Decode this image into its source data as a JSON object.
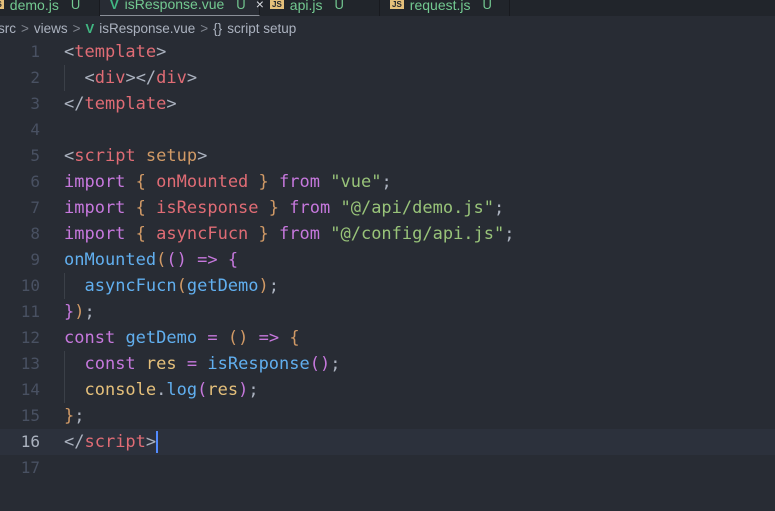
{
  "tabs": [
    {
      "label": "demo.js",
      "status": "U",
      "icon": "js-icon",
      "active": false
    },
    {
      "label": "isResponse.vue",
      "status": "U",
      "icon": "vue-icon",
      "active": true
    },
    {
      "label": "api.js",
      "status": "U",
      "icon": "js-icon",
      "active": false
    },
    {
      "label": "request.js",
      "status": "U",
      "icon": "js-icon",
      "active": false
    }
  ],
  "tab_close": "×",
  "js_badge": "JS",
  "breadcrumb": {
    "items": [
      "src",
      "views",
      "isResponse.vue",
      "script setup"
    ],
    "sep": ">",
    "braces": "{}",
    "vue_glyph": "V"
  },
  "current_line": 16,
  "line_numbers": [
    "1",
    "2",
    "3",
    "4",
    "5",
    "6",
    "7",
    "8",
    "9",
    "10",
    "11",
    "12",
    "13",
    "14",
    "15",
    "16",
    "17"
  ],
  "code": [
    [
      [
        "<",
        "punc"
      ],
      [
        "template",
        "tag"
      ],
      [
        ">",
        "punc"
      ]
    ],
    [
      [
        "  ",
        "punc"
      ],
      [
        "<",
        "punc"
      ],
      [
        "div",
        "tag"
      ],
      [
        "></",
        "punc"
      ],
      [
        "div",
        "tag"
      ],
      [
        ">",
        "punc"
      ]
    ],
    [
      [
        "</",
        "punc"
      ],
      [
        "template",
        "tag"
      ],
      [
        ">",
        "punc"
      ]
    ],
    [],
    [
      [
        "<",
        "punc"
      ],
      [
        "script",
        "tag"
      ],
      [
        " ",
        "punc"
      ],
      [
        "setup",
        "attr"
      ],
      [
        ">",
        "punc"
      ]
    ],
    [
      [
        "import",
        "kw"
      ],
      [
        " ",
        "punc"
      ],
      [
        "{",
        "brace"
      ],
      [
        " ",
        "punc"
      ],
      [
        "onMounted",
        "var"
      ],
      [
        " ",
        "punc"
      ],
      [
        "}",
        "brace"
      ],
      [
        " ",
        "punc"
      ],
      [
        "from",
        "kw"
      ],
      [
        " ",
        "punc"
      ],
      [
        "\"vue\"",
        "str"
      ],
      [
        ";",
        "punc"
      ]
    ],
    [
      [
        "import",
        "kw"
      ],
      [
        " ",
        "punc"
      ],
      [
        "{",
        "brace"
      ],
      [
        " ",
        "punc"
      ],
      [
        "isResponse",
        "var"
      ],
      [
        " ",
        "punc"
      ],
      [
        "}",
        "brace"
      ],
      [
        " ",
        "punc"
      ],
      [
        "from",
        "kw"
      ],
      [
        " ",
        "punc"
      ],
      [
        "\"@/api/demo.js\"",
        "str"
      ],
      [
        ";",
        "punc"
      ]
    ],
    [
      [
        "import",
        "kw"
      ],
      [
        " ",
        "punc"
      ],
      [
        "{",
        "brace"
      ],
      [
        " ",
        "punc"
      ],
      [
        "asyncFucn",
        "var"
      ],
      [
        " ",
        "punc"
      ],
      [
        "}",
        "brace"
      ],
      [
        " ",
        "punc"
      ],
      [
        "from",
        "kw"
      ],
      [
        " ",
        "punc"
      ],
      [
        "\"@/config/api.js\"",
        "str"
      ],
      [
        ";",
        "punc"
      ]
    ],
    [
      [
        "onMounted",
        "fn"
      ],
      [
        "(",
        "paren"
      ],
      [
        "()",
        "paren2"
      ],
      [
        " ",
        "punc"
      ],
      [
        "=>",
        "op"
      ],
      [
        " ",
        "punc"
      ],
      [
        "{",
        "paren2"
      ]
    ],
    [
      [
        "  ",
        "punc"
      ],
      [
        "asyncFucn",
        "fn"
      ],
      [
        "(",
        "paren"
      ],
      [
        "getDemo",
        "fn"
      ],
      [
        ")",
        "paren"
      ],
      [
        ";",
        "punc"
      ]
    ],
    [
      [
        "}",
        "paren2"
      ],
      [
        ")",
        "paren"
      ],
      [
        ";",
        "punc"
      ]
    ],
    [
      [
        "const",
        "kw"
      ],
      [
        " ",
        "punc"
      ],
      [
        "getDemo",
        "fn"
      ],
      [
        " ",
        "punc"
      ],
      [
        "=",
        "op"
      ],
      [
        " ",
        "punc"
      ],
      [
        "()",
        "paren"
      ],
      [
        " ",
        "punc"
      ],
      [
        "=>",
        "op"
      ],
      [
        " ",
        "punc"
      ],
      [
        "{",
        "paren"
      ]
    ],
    [
      [
        "  ",
        "punc"
      ],
      [
        "const",
        "kw"
      ],
      [
        " ",
        "punc"
      ],
      [
        "res",
        "obj"
      ],
      [
        " ",
        "punc"
      ],
      [
        "=",
        "op"
      ],
      [
        " ",
        "punc"
      ],
      [
        "isResponse",
        "fn"
      ],
      [
        "()",
        "paren2"
      ],
      [
        ";",
        "punc"
      ]
    ],
    [
      [
        "  ",
        "punc"
      ],
      [
        "console",
        "obj"
      ],
      [
        ".",
        "punc"
      ],
      [
        "log",
        "fn"
      ],
      [
        "(",
        "paren2"
      ],
      [
        "res",
        "obj"
      ],
      [
        ")",
        "paren2"
      ],
      [
        ";",
        "punc"
      ]
    ],
    [
      [
        "}",
        "paren"
      ],
      [
        ";",
        "punc"
      ]
    ],
    [
      [
        "</",
        "punc"
      ],
      [
        "script",
        "tag"
      ],
      [
        ">",
        "punc"
      ]
    ],
    []
  ],
  "colors": {
    "background": "#282c34",
    "tabbar": "#21252b",
    "untracked": "#73c991",
    "cursor": "#528bff"
  }
}
